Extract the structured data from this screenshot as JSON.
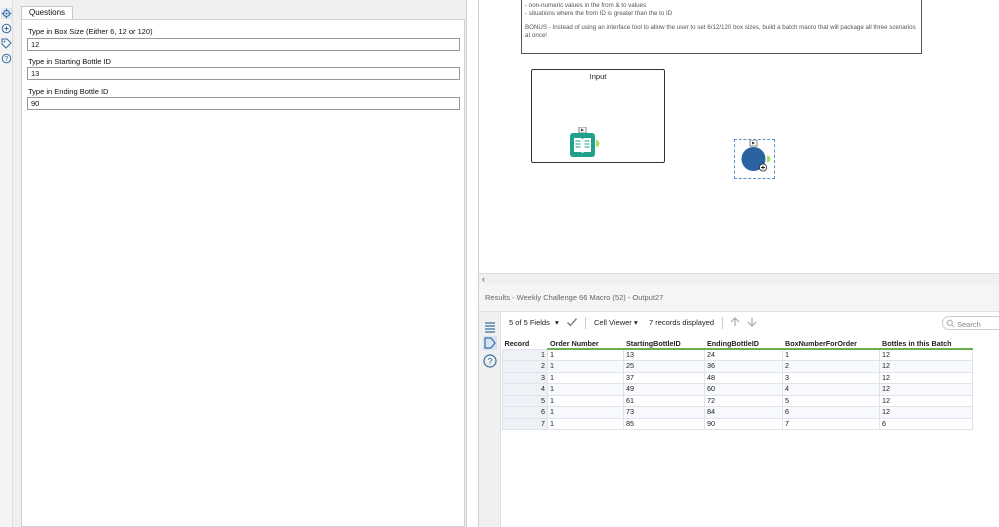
{
  "left_strip": {
    "icons": [
      "gear-icon",
      "tool-icon",
      "tag-icon",
      "help-icon"
    ]
  },
  "config": {
    "tab_label": "Questions",
    "questions": [
      {
        "label": "Type in Box Size (Either 6, 12 or 120)",
        "value": "12"
      },
      {
        "label": "Type in Starting Bottle ID",
        "value": "13"
      },
      {
        "label": "Type in Ending Bottle ID",
        "value": "90"
      }
    ]
  },
  "canvas": {
    "comment_lines": [
      "- non-numeric values in the from & to values",
      "- situations where the from ID is greater than the to ID",
      "",
      "BONUS - Instead of using an interface tool to allow the user to set 6/12/120 box sizes, build a batch macro that will package all three scenarios at once!"
    ],
    "container_title": "Input",
    "colors": {
      "input_tool": "#1fa18e",
      "macro_tool": "#2a63a0",
      "anchor": "#a5e06a"
    }
  },
  "results": {
    "title": "Results - Weekly Challenge 66 Macro (52) - Output27",
    "toolbar": {
      "fields_label": "5 of 5 Fields",
      "viewer_label": "Cell Viewer",
      "records_label": "7 records displayed",
      "search_placeholder": "Search"
    },
    "columns": [
      "Record",
      "Order Number",
      "StartingBottleID",
      "EndingBottleID",
      "BoxNumberForOrder",
      "Bottles in this Batch"
    ],
    "rows": [
      [
        "1",
        "1",
        "13",
        "24",
        "1",
        "12"
      ],
      [
        "2",
        "1",
        "25",
        "36",
        "2",
        "12"
      ],
      [
        "3",
        "1",
        "37",
        "48",
        "3",
        "12"
      ],
      [
        "4",
        "1",
        "49",
        "60",
        "4",
        "12"
      ],
      [
        "5",
        "1",
        "61",
        "72",
        "5",
        "12"
      ],
      [
        "6",
        "1",
        "73",
        "84",
        "6",
        "12"
      ],
      [
        "7",
        "1",
        "85",
        "90",
        "7",
        "6"
      ]
    ]
  }
}
